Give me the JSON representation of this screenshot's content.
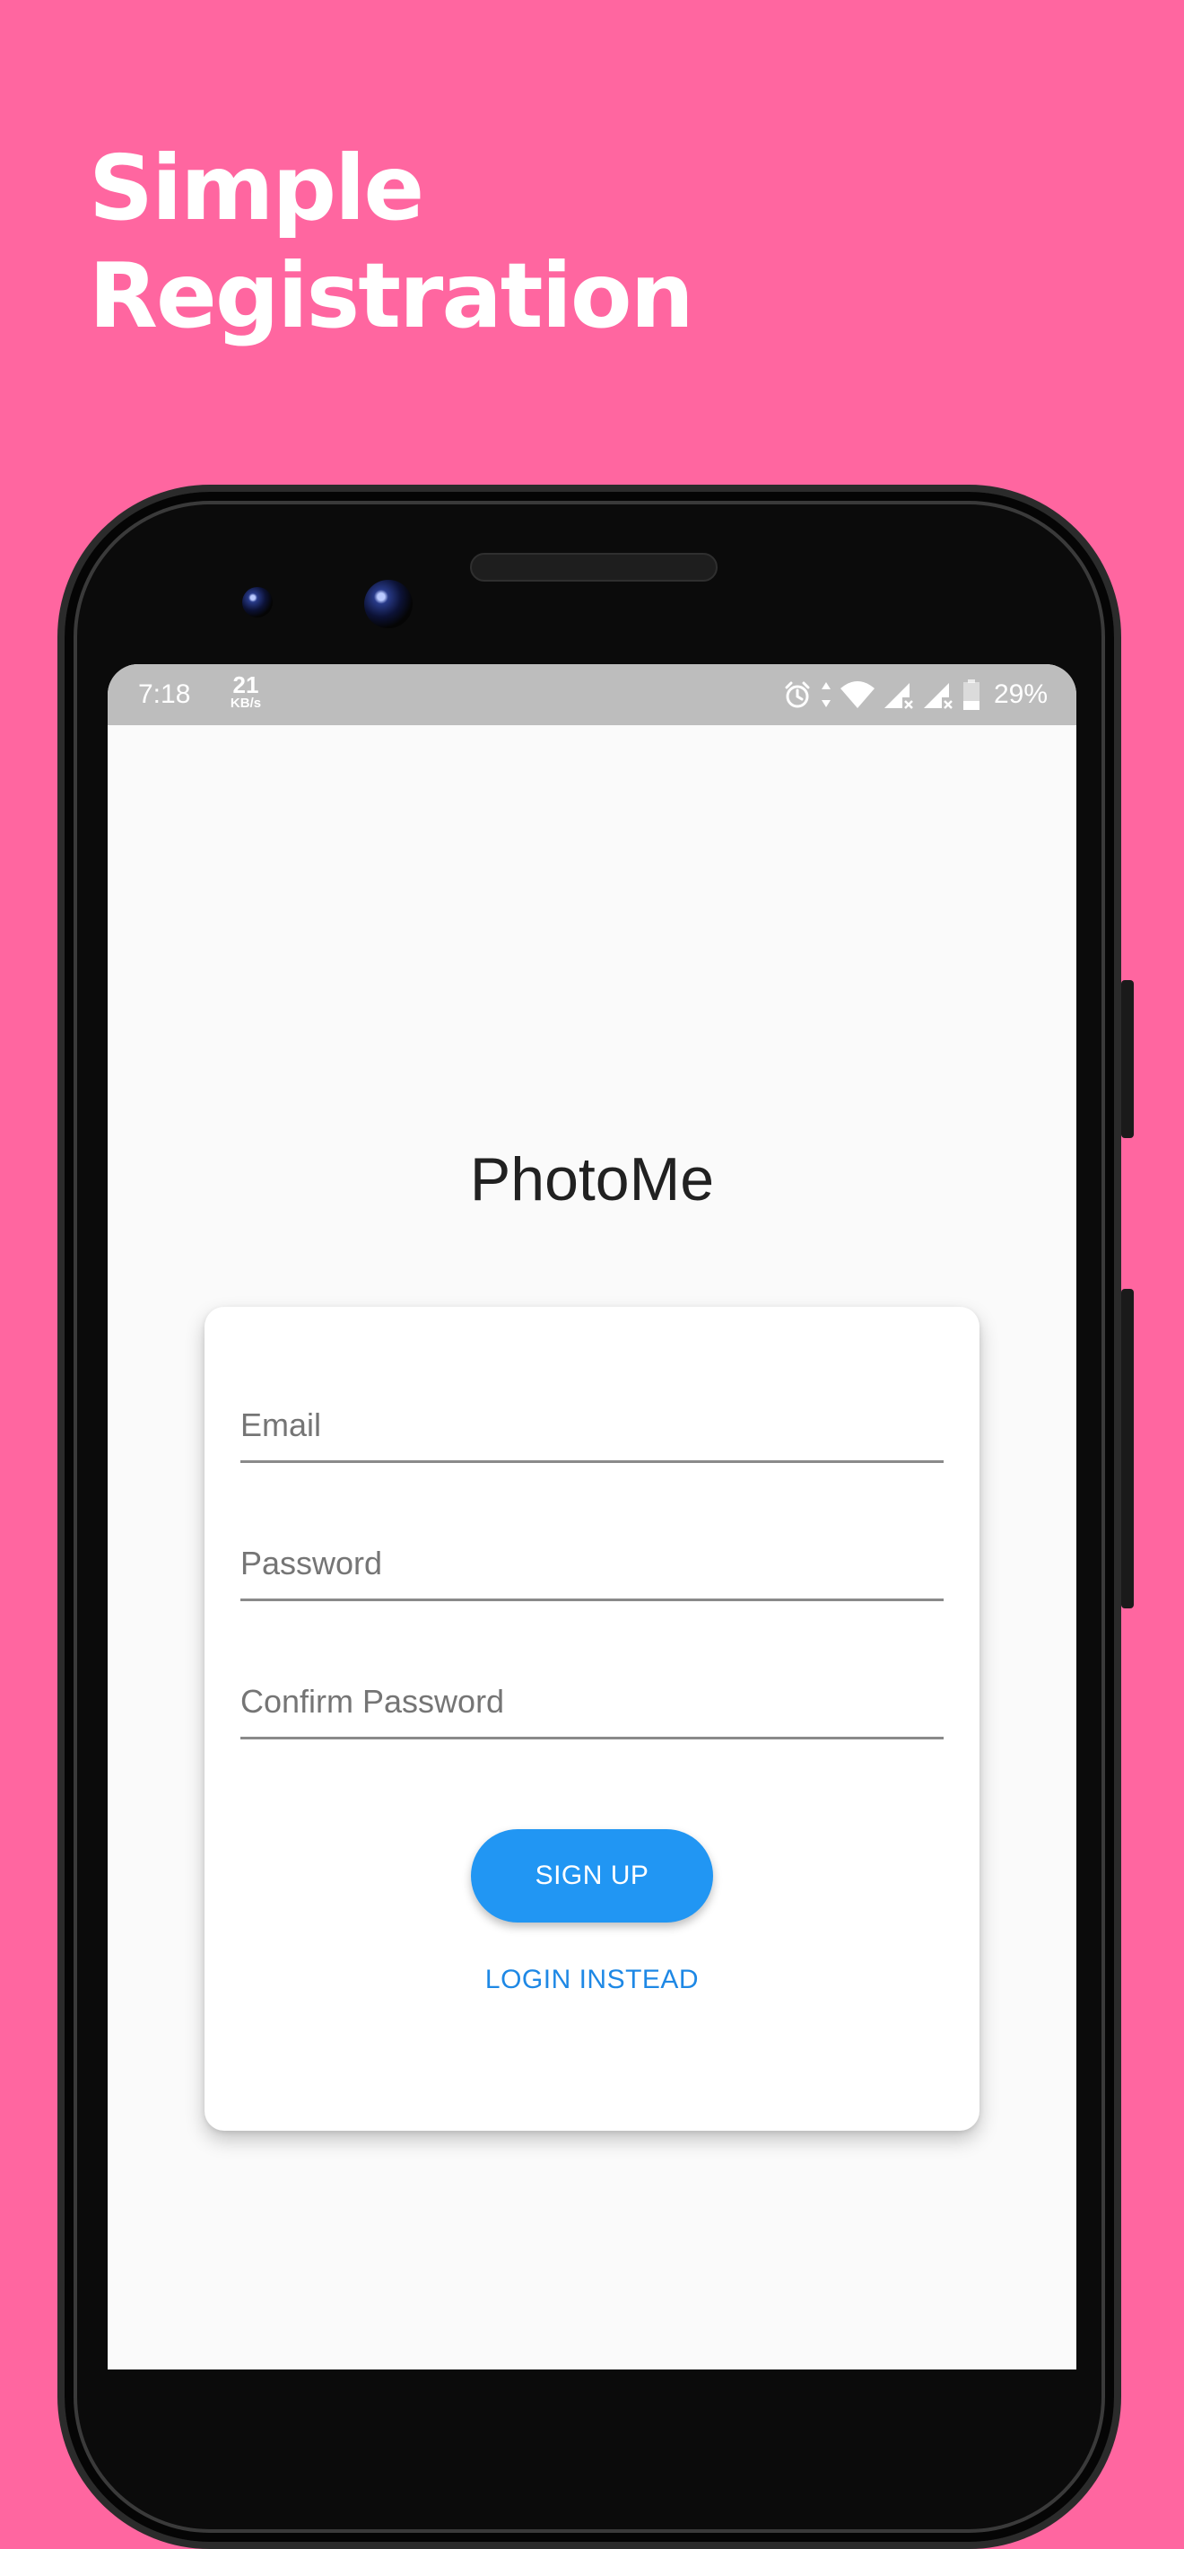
{
  "promo": {
    "headline_line1": "Simple",
    "headline_line2": "Registration",
    "background_color": "#ff66a0"
  },
  "status_bar": {
    "time": "7:18",
    "network_speed_value": "21",
    "network_speed_unit": "KB/s",
    "icons": [
      "alarm-icon",
      "data-transfer-icon",
      "wifi-icon",
      "cellular-no-signal-icon",
      "cellular-no-signal-icon",
      "battery-icon"
    ],
    "battery_percent": "29%"
  },
  "app": {
    "title": "PhotoMe"
  },
  "form": {
    "email": {
      "value": "",
      "placeholder": "Email"
    },
    "password": {
      "value": "",
      "placeholder": "Password"
    },
    "confirm_password": {
      "value": "",
      "placeholder": "Confirm Password"
    },
    "signup_label": "SIGN UP",
    "login_link_label": "LOGIN INSTEAD"
  },
  "colors": {
    "accent": "#2196f3",
    "link": "#1e88e5",
    "status_bar": "#bdbdbd"
  }
}
